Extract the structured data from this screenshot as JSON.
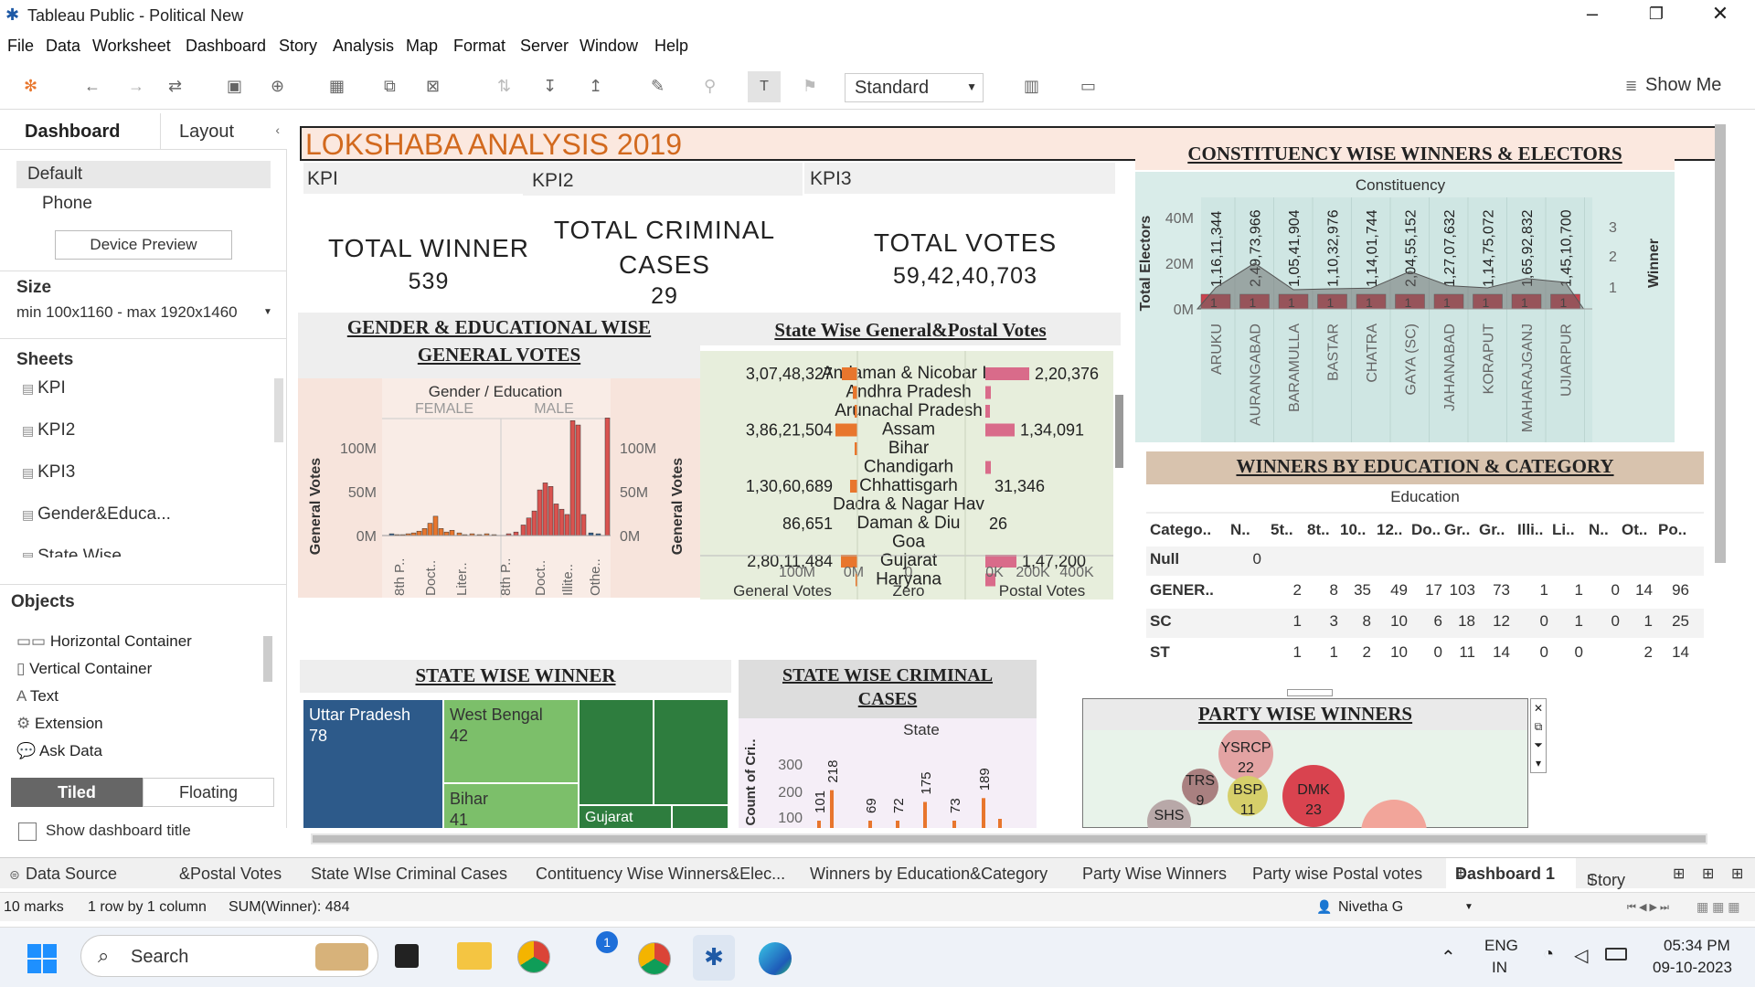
{
  "window": {
    "title": "Tableau Public - Political New"
  },
  "menu": [
    "File",
    "Data",
    "Worksheet",
    "Dashboard",
    "Story",
    "Analysis",
    "Map",
    "Format",
    "Server",
    "Window",
    "Help"
  ],
  "toolbar": {
    "fit": "Standard",
    "show_me": "Show Me"
  },
  "left": {
    "tab_dashboard": "Dashboard",
    "tab_layout": "Layout",
    "device_default": "Default",
    "device_phone": "Phone",
    "device_preview": "Device Preview",
    "size_heading": "Size",
    "size_value": "min 100x1160 - max 1920x1460",
    "sheets_heading": "Sheets",
    "sheets": [
      "KPI",
      "KPI2",
      "KPI3",
      "Gender&Educa...",
      "State Wise..."
    ],
    "objects_heading": "Objects",
    "objects": [
      "Horizontal Container",
      "Vertical Container",
      "Text",
      "Extension",
      "Ask Data"
    ],
    "tiled": "Tiled",
    "floating": "Floating",
    "show_title": "Show dashboard title"
  },
  "dashboard": {
    "title": "LOKSHABA ANALYSIS 2019",
    "kpi1": {
      "label": "KPI",
      "text": "TOTAL WINNER",
      "value": "539"
    },
    "kpi2": {
      "label": "KPI2",
      "text1": "TOTAL CRIMINAL",
      "text2": "CASES",
      "value": "29"
    },
    "kpi3": {
      "label": "KPI3",
      "text": "TOTAL VOTES",
      "value": "59,42,40,703"
    },
    "gender_title1": "GENDER & EDUCATIONAL WISE",
    "gender_title2": "GENERAL VOTES",
    "gender_header": "Gender / Education",
    "gender_female": "FEMALE",
    "gender_male": "MALE",
    "gender_ylabel": "General Votes",
    "gender_yticks": [
      "100M",
      "50M",
      "0M"
    ],
    "gender_xlabels": [
      "8th P..",
      "Doct..",
      "Liter..",
      "8th P..",
      "Doct..",
      "Illite..",
      "Othe.."
    ],
    "state_gp_title": "State Wise General&Postal Votes",
    "state_gp_states": [
      "Andaman & Nicobar Is",
      "Andhra Pradesh",
      "Arunachal Pradesh",
      "Assam",
      "Bihar",
      "Chandigarh",
      "Chhattisgarh",
      "Dadra & Nagar Hav",
      "Daman & Diu",
      "Goa",
      "Gujarat",
      "Haryana"
    ],
    "state_gp_general_labels": [
      "3,07,48,327",
      "3,86,21,504",
      "1,30,60,689",
      "86,651",
      "2,80,11,484"
    ],
    "state_gp_postal_labels": [
      "2,20,376",
      "1,34,091",
      "31,346",
      "26",
      "1,47,200"
    ],
    "state_gp_ticks_general": [
      "100M",
      "0M"
    ],
    "state_gp_ticks_zero": [
      "0"
    ],
    "state_gp_ticks_postal": [
      "0K",
      "200K",
      "400K"
    ],
    "state_gp_axis_general": "General Votes",
    "state_gp_axis_zero": "Zero",
    "state_gp_axis_postal": "Postal Votes",
    "const_title": "CONSTITUENCY WISE WINNERS & ELECTORS",
    "const_header": "Constituency",
    "const_ylabel": "Total Electors",
    "const_yticks": [
      "40M",
      "20M",
      "0M"
    ],
    "const_rticks": [
      "3",
      "2",
      "1"
    ],
    "const_rlabel": "Winner",
    "const_names": [
      "ARUKU",
      "AURANGABAD",
      "BARAMULLA",
      "BASTAR",
      "CHATRA",
      "GAYA (SC)",
      "JAHANABAD",
      "KORAPUT",
      "MAHARAJGANJ",
      "UJIARPUR"
    ],
    "const_electors": [
      "1,16,11,344",
      "2,49,73,966",
      "1,05,41,904",
      "1,10,32,976",
      "1,14,01,744",
      "2,04,55,152",
      "1,27,07,632",
      "1,14,75,072",
      "1,65,92,832",
      "1,45,10,700"
    ],
    "edu_title": "WINNERS BY EDUCATION & CATEGORY",
    "edu_header": "Education",
    "edu_columns": [
      "Catego..",
      "N..",
      "5t..",
      "8t..",
      "10..",
      "12..",
      "Do..",
      "Gr..",
      "Gr..",
      "Illi..",
      "Li..",
      "N..",
      "Ot..",
      "Po.."
    ],
    "edu_rows": [
      {
        "cat": "Null",
        "vals": [
          "0",
          "",
          "",
          "",
          "",
          "",
          "",
          "",
          "",
          "",
          "",
          "",
          ""
        ]
      },
      {
        "cat": "GENER..",
        "vals": [
          "",
          "2",
          "8",
          "35",
          "49",
          "17",
          "103",
          "73",
          "1",
          "1",
          "0",
          "14",
          "96"
        ]
      },
      {
        "cat": "SC",
        "vals": [
          "",
          "1",
          "3",
          "8",
          "10",
          "6",
          "18",
          "12",
          "0",
          "1",
          "0",
          "1",
          "25"
        ]
      },
      {
        "cat": "ST",
        "vals": [
          "",
          "1",
          "1",
          "2",
          "10",
          "0",
          "11",
          "14",
          "0",
          "0",
          "",
          "2",
          "14"
        ]
      }
    ],
    "swwinner_title": "STATE WISE WINNER",
    "treemap": [
      {
        "name": "Uttar Pradesh",
        "value": "78"
      },
      {
        "name": "West Bengal",
        "value": "42"
      },
      {
        "name": "Bihar",
        "value": "41"
      },
      {
        "name": "Gujarat",
        "value": ""
      }
    ],
    "criminal_title1": "STATE WISE CRIMINAL",
    "criminal_title2": "CASES",
    "criminal_header": "State",
    "criminal_ylabel": "Count of Cri..",
    "criminal_yticks": [
      "300",
      "200",
      "100"
    ],
    "criminal_labels": [
      "101",
      "218",
      "69",
      "72",
      "175",
      "73",
      "189"
    ],
    "party_title": "PARTY WISE WINNERS",
    "party_bubbles": [
      {
        "name": "YSRCP",
        "value": "22"
      },
      {
        "name": "TRS",
        "value": "9"
      },
      {
        "name": "BSP",
        "value": "11"
      },
      {
        "name": "DMK",
        "value": "23"
      },
      {
        "name": "SHS",
        "value": ""
      }
    ]
  },
  "tabs": [
    "Data Source",
    "&Postal Votes",
    "State WIse Criminal Cases",
    "Contituency Wise Winners&Elec...",
    "Winners by Education&Category",
    "Party Wise Winners",
    "Party wise Postal votes",
    "Dashboard 1",
    "Story 1"
  ],
  "status": {
    "marks": "10 marks",
    "rows": "1 row by 1 column",
    "sum": "SUM(Winner): 484",
    "user": "Nivetha G"
  },
  "taskbar": {
    "search": "Search",
    "lang1": "ENG",
    "lang2": "IN",
    "time": "05:34 PM",
    "date": "09-10-2023",
    "badge": "1"
  }
}
